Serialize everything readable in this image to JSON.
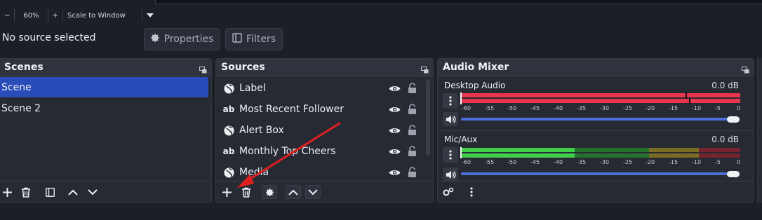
{
  "zoom": {
    "minus": "−",
    "percent": "60%",
    "plus": "+",
    "scale_mode": "Scale to Window"
  },
  "context": {
    "no_source": "No source selected",
    "properties": "Properties",
    "filters": "Filters"
  },
  "scenes": {
    "title": "Scenes",
    "items": [
      {
        "label": "Scene",
        "selected": true
      },
      {
        "label": "Scene 2",
        "selected": false
      }
    ]
  },
  "sources": {
    "title": "Sources",
    "items": [
      {
        "label": "Label",
        "icon": "globe-icon"
      },
      {
        "label": "Most Recent Follower",
        "icon": "text-ab-icon"
      },
      {
        "label": "Alert Box",
        "icon": "globe-icon"
      },
      {
        "label": "Monthly Top Cheers",
        "icon": "text-ab-icon"
      },
      {
        "label": "Media",
        "icon": "globe-icon"
      }
    ]
  },
  "mixer": {
    "title": "Audio Mixer",
    "channels": [
      {
        "name": "Desktop Audio",
        "db": "0.0 dB"
      },
      {
        "name": "Mic/Aux",
        "db": "0.0 dB"
      }
    ],
    "scale": [
      "-60",
      "-55",
      "-50",
      "-45",
      "-40",
      "-35",
      "-30",
      "-25",
      "-20",
      "-15",
      "-10",
      "-5",
      "0"
    ]
  },
  "annotation": {
    "arrow_color": "#e02020"
  },
  "colors": {
    "accent": "#284cb8",
    "meter_red": "#e8364e",
    "meter_green": "#3fd049"
  }
}
